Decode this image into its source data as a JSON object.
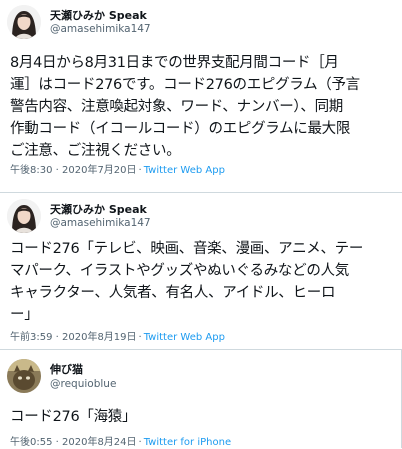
{
  "tweets": [
    {
      "display_name": "天瀬ひみか Speak",
      "handle": "@amasehimika147",
      "text": "8月4日から8月31日までの世界支配月間コード［月\n運］はコード276です。コード276のエピグラム（予言\n警告内容、注意喚起対象、ワード、ナンバー）、同期\n作動コード（イコールコード）のエピグラムに最大限\nご注意、ご注視ください。",
      "time": "午後8:30 · 2020年7月20日",
      "dot": "·",
      "source": "Twitter Web App"
    },
    {
      "display_name": "天瀬ひみか Speak",
      "handle": "@amasehimika147",
      "text": "コード276「テレビ、映画、音楽、漫画、アニメ、テー\nマパーク、イラストやグッズやぬいぐるみなどの人気\nキャラクター、人気者、有名人、アイドル、ヒーロ\nー」",
      "time": "午前3:59 · 2020年8月19日",
      "dot": "·",
      "source": "Twitter Web App"
    },
    {
      "display_name": "伸び猫",
      "handle": "@requioblue",
      "text": "コード276「海猿」",
      "time": "午後0:55 · 2020年8月24日",
      "dot": "·",
      "source": "Twitter for iPhone"
    }
  ],
  "colors": {
    "link": "#1d9bf0",
    "muted": "#536471",
    "text": "#0f1419"
  }
}
